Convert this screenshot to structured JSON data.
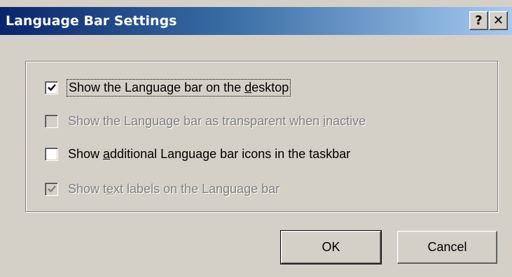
{
  "window": {
    "title": "Language Bar Settings",
    "help_glyph": "?",
    "close_glyph": "✕"
  },
  "options": [
    {
      "pre": "Show the Language bar on the ",
      "mnemonic": "d",
      "post": "esktop",
      "checked": true,
      "enabled": true
    },
    {
      "pre": "Show the Language bar as transparent when ",
      "mnemonic": "i",
      "post": "nactive",
      "checked": false,
      "enabled": false
    },
    {
      "pre": "Show ",
      "mnemonic": "a",
      "post": "dditional Language bar icons in the taskbar",
      "checked": false,
      "enabled": true
    },
    {
      "pre": "Show t",
      "mnemonic": "e",
      "post": "xt labels on the Language bar",
      "checked": true,
      "enabled": false
    }
  ],
  "buttons": {
    "ok_label": "OK",
    "cancel_label": "Cancel"
  },
  "colors": {
    "titlebar_start": "#0a246a",
    "titlebar_end": "#a6caf0",
    "face": "#d4d0c8",
    "disabled_text": "#808080"
  }
}
